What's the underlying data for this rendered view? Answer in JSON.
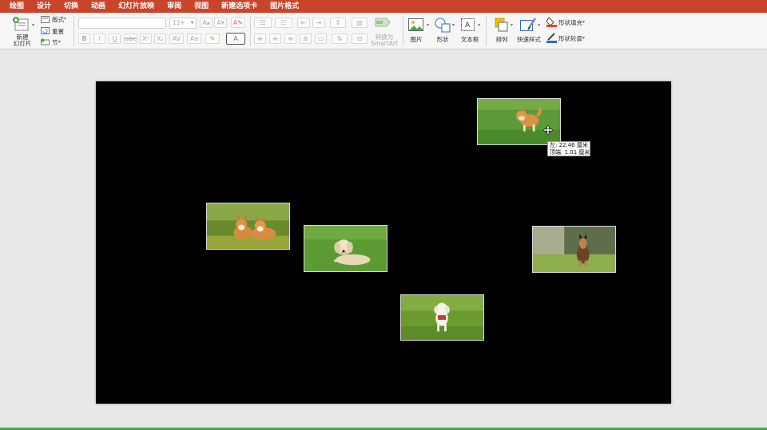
{
  "tabs": [
    {
      "label": "绘图",
      "active": false
    },
    {
      "label": "设计",
      "active": false
    },
    {
      "label": "切换",
      "active": false
    },
    {
      "label": "动画",
      "active": false
    },
    {
      "label": "幻灯片放映",
      "active": false
    },
    {
      "label": "审阅",
      "active": false
    },
    {
      "label": "视图",
      "active": false
    },
    {
      "label": "新建选项卡",
      "active": false
    },
    {
      "label": "图片格式",
      "active": false
    }
  ],
  "ribbon": {
    "slides": {
      "new_slide": "新建\n幻灯片",
      "layout": "版式",
      "reset": "重置",
      "section": "节"
    },
    "font": {
      "font_name": "",
      "font_size": "12+"
    },
    "paragraph": {
      "convert_smartart": "转换为\nSmartArt"
    },
    "insert": {
      "picture": "图片",
      "shape": "形状",
      "textbox": "文本框"
    },
    "arrange": {
      "arrange": "排列",
      "quick_styles": "快速样式",
      "shape_fill": "形状填充",
      "shape_outline": "形状轮廓"
    }
  },
  "tooltip": {
    "left": "左: 22.46 厘米",
    "top": "顶端: 1.01 厘米"
  },
  "photos": [
    {
      "subject": "shiba-inu-running"
    },
    {
      "subject": "two-corgis"
    },
    {
      "subject": "golden-retriever-lying"
    },
    {
      "subject": "german-shepherd-sitting"
    },
    {
      "subject": "white-poodle-standing"
    }
  ],
  "colors": {
    "tabbar": "#c8452b",
    "ribbon": "#f6f6f6",
    "workspace": "#e8e8e8",
    "slide": "#000000",
    "shape_fill_accent": "#e8402a",
    "shape_outline_accent": "#2f6bc3"
  }
}
